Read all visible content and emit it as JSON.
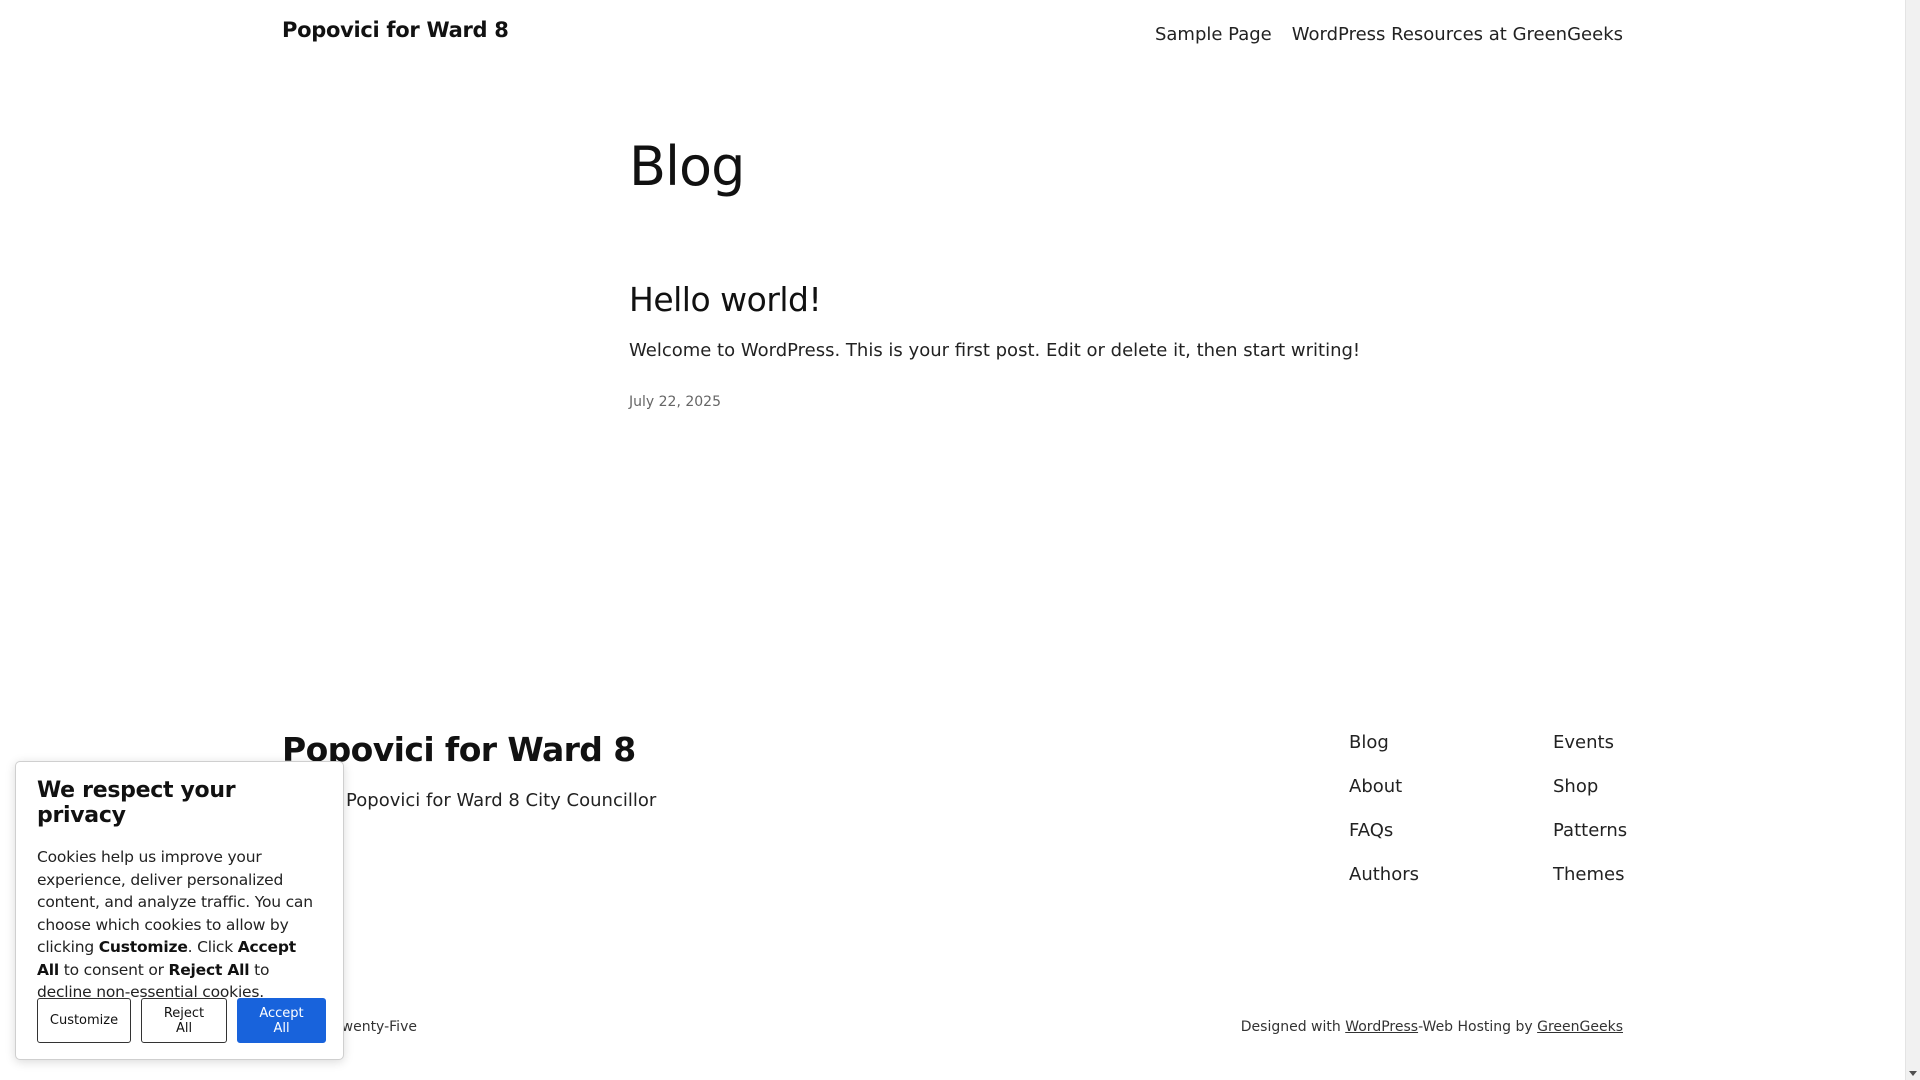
{
  "header": {
    "site_title": "Popovici for Ward 8",
    "nav": [
      "Sample Page",
      "WordPress Resources at GreenGeeks"
    ]
  },
  "main": {
    "heading": "Blog",
    "post": {
      "title": "Hello world!",
      "excerpt": "Welcome to WordPress. This is your first post. Edit or delete it, then start writing!",
      "date": "July 22, 2025"
    }
  },
  "footer": {
    "title": "Popovici for Ward 8",
    "tagline": "Stefan Popovici for Ward 8 City Councillor",
    "nav_col1": [
      "Blog",
      "About",
      "FAQs",
      "Authors"
    ],
    "nav_col2": [
      "Events",
      "Shop",
      "Patterns",
      "Themes"
    ],
    "credit_left": "Twenty Twenty-Five",
    "credit_right": {
      "prefix": "Designed with ",
      "wordpress": "WordPress",
      "middle": "-Web Hosting by ",
      "greengeeks": "GreenGeeks"
    }
  },
  "cookie_banner": {
    "title": "We respect your privacy",
    "text_1": "Cookies help us improve your experience, deliver personalized content, and analyze traffic. You can choose which cookies to allow by clicking ",
    "bold_customize": "Customize",
    "text_2": ". Click ",
    "bold_accept": "Accept All",
    "text_3": " to consent or ",
    "bold_reject": "Reject All",
    "text_4": " to decline non-essential cookies.",
    "buttons": {
      "customize": "Customize",
      "reject": "Reject All",
      "accept": "Accept All"
    },
    "accent_color": "#1863dc"
  }
}
